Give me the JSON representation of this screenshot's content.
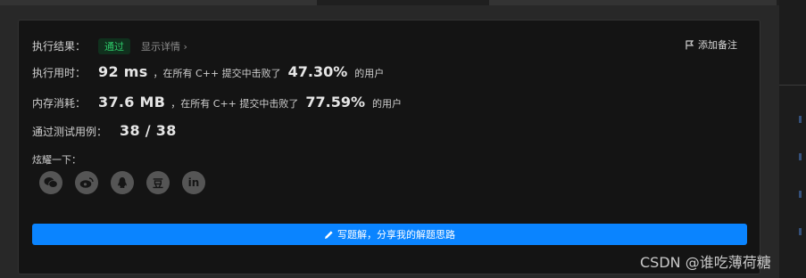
{
  "result": {
    "label": "执行结果：",
    "status": "通过",
    "detail_link": "显示详情 ›"
  },
  "add_note": "添加备注",
  "runtime": {
    "label": "执行用时：",
    "value": "92 ms",
    "beat_text": "，在所有 C++ 提交中击败了",
    "percent": "47.30%",
    "suffix": "的用户"
  },
  "memory": {
    "label": "内存消耗：",
    "value": "37.6 MB",
    "beat_text": "，在所有 C++ 提交中击败了",
    "percent": "77.59%",
    "suffix": "的用户"
  },
  "testcases": {
    "label": "通过测试用例：",
    "value": "38 / 38"
  },
  "share": {
    "label": "炫耀一下：",
    "icons": [
      {
        "name": "wechat-icon",
        "glyph": ""
      },
      {
        "name": "weibo-icon",
        "glyph": ""
      },
      {
        "name": "qq-icon",
        "glyph": ""
      },
      {
        "name": "douban-icon",
        "glyph": "豆"
      },
      {
        "name": "linkedin-icon",
        "glyph": "in"
      }
    ]
  },
  "cta_label": "写题解，分享我的解题思路",
  "watermark": "CSDN @谁吃薄荷糖"
}
